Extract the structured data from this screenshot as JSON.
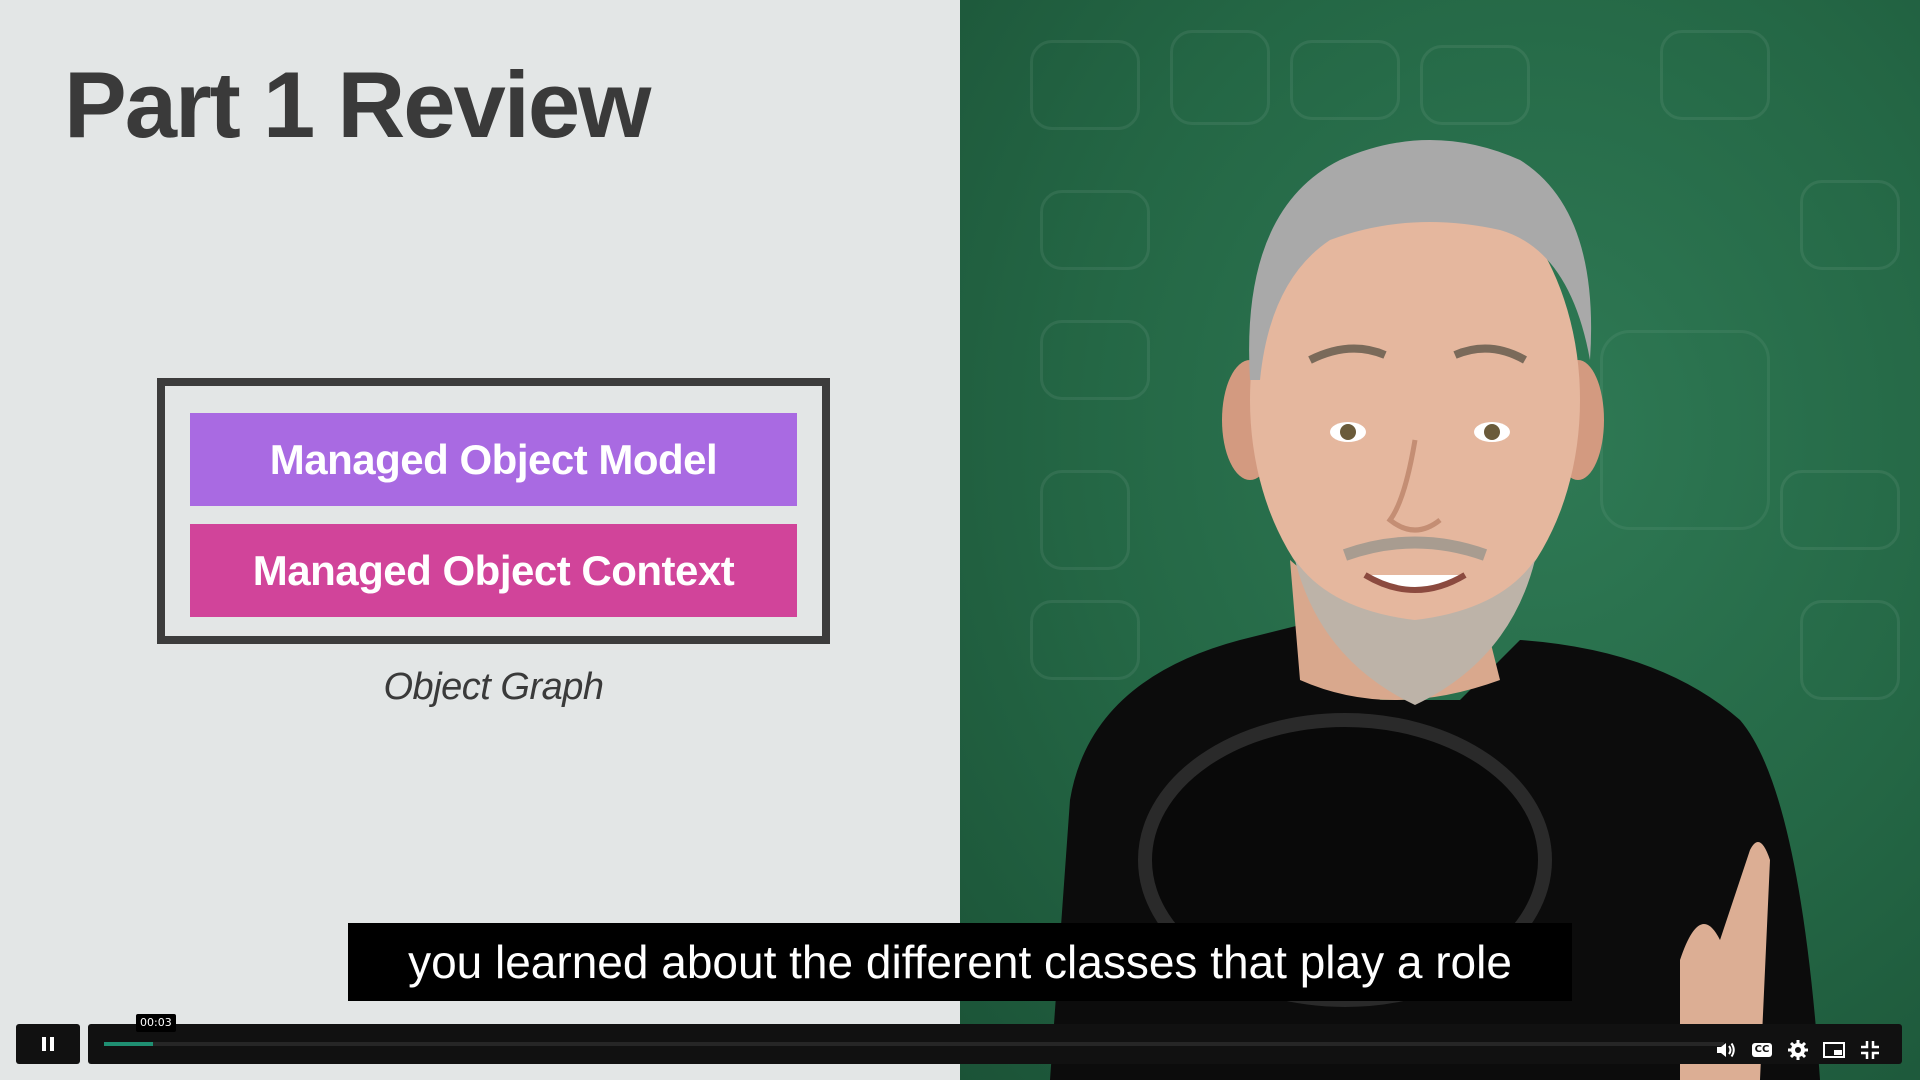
{
  "slide": {
    "title": "Part 1 Review",
    "graph": {
      "model_label": "Managed Object Model",
      "context_label": "Managed Object Context",
      "caption": "Object Graph",
      "colors": {
        "model": "#a96ae2",
        "context": "#d1449a",
        "border": "#3c3c3c"
      }
    }
  },
  "subtitle": {
    "text": "you learned about the different classes that play a role"
  },
  "player": {
    "current_time": "00:03",
    "progress_fraction": 0.03,
    "accent_color": "#1f8f72",
    "icons": [
      "pause-icon",
      "volume-icon",
      "closed-captions-icon",
      "settings-icon",
      "picture-in-picture-icon",
      "exit-fullscreen-icon"
    ],
    "cc_label": "CC"
  }
}
